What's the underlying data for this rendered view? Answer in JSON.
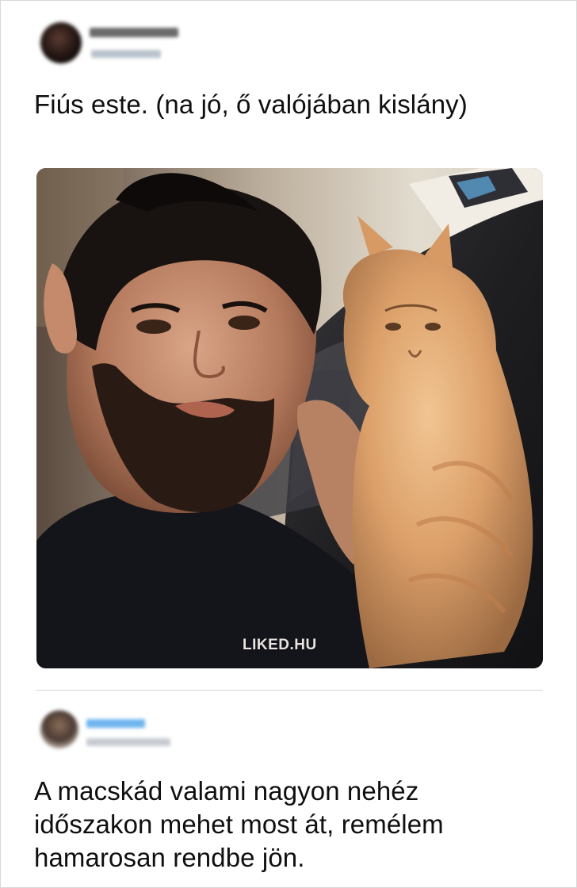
{
  "tweet": {
    "text": "Fiús este. (na jó, ő valójában kislány)",
    "image": {
      "watermark": "LIKED.HU"
    }
  },
  "reply": {
    "text": "A macskád valami nagyon nehéz időszakon mehet most át, remélem hamarosan rendbe jön."
  },
  "colors": {
    "text": "#0f0f0f",
    "divider": "#d6d6d6",
    "reply_name_blue": "#6fb5ee"
  }
}
